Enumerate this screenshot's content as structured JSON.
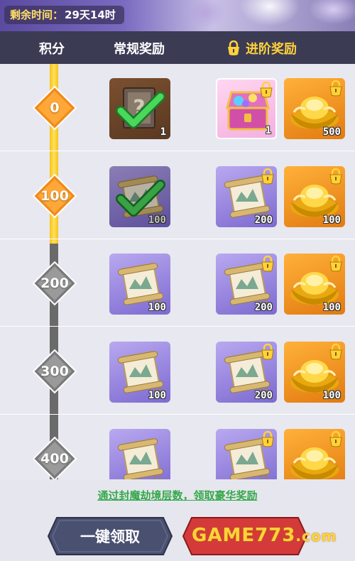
{
  "header": {
    "timer_label": "剩余时间：",
    "timer_value": "29天14时"
  },
  "tabs": {
    "score": "积分",
    "normal": "常规奖励",
    "advanced": "进阶奖励"
  },
  "rows": [
    {
      "score": "0",
      "reached": true,
      "normal": {
        "type": "mystery-book",
        "count": "1",
        "claimed": true
      },
      "adv1": {
        "type": "treasure-chest",
        "count": "1",
        "locked": true
      },
      "adv2": {
        "type": "gold-ingot",
        "count": "500",
        "locked": true
      }
    },
    {
      "score": "100",
      "reached": true,
      "normal": {
        "type": "scroll",
        "count": "100",
        "claimed": true
      },
      "adv1": {
        "type": "scroll",
        "count": "200",
        "locked": true
      },
      "adv2": {
        "type": "gold-ingot",
        "count": "100",
        "locked": true
      }
    },
    {
      "score": "200",
      "reached": false,
      "normal": {
        "type": "scroll",
        "count": "100",
        "claimed": false
      },
      "adv1": {
        "type": "scroll",
        "count": "200",
        "locked": true
      },
      "adv2": {
        "type": "gold-ingot",
        "count": "100",
        "locked": true
      }
    },
    {
      "score": "300",
      "reached": false,
      "normal": {
        "type": "scroll",
        "count": "100",
        "claimed": false
      },
      "adv1": {
        "type": "scroll",
        "count": "200",
        "locked": true
      },
      "adv2": {
        "type": "gold-ingot",
        "count": "100",
        "locked": true
      }
    },
    {
      "score": "400",
      "reached": false,
      "normal": {
        "type": "scroll",
        "count": "",
        "claimed": false
      },
      "adv1": {
        "type": "scroll",
        "count": "",
        "locked": true
      },
      "adv2": {
        "type": "gold-ingot",
        "count": "",
        "locked": true
      }
    }
  ],
  "footer": {
    "hint": "通过封魔劫境层数，领取豪华奖励",
    "claim_all": "一键领取",
    "watermark_main": "GAME773",
    "watermark_suffix": ".com"
  },
  "colors": {
    "progress_fill": "#f7c21a",
    "reached_diamond": "#f08a1a",
    "locked_diamond": "#7a7a7a",
    "hint_green": "#34a84a",
    "claim_button": "#4a5070",
    "unlock_button": "#d43a3a"
  }
}
